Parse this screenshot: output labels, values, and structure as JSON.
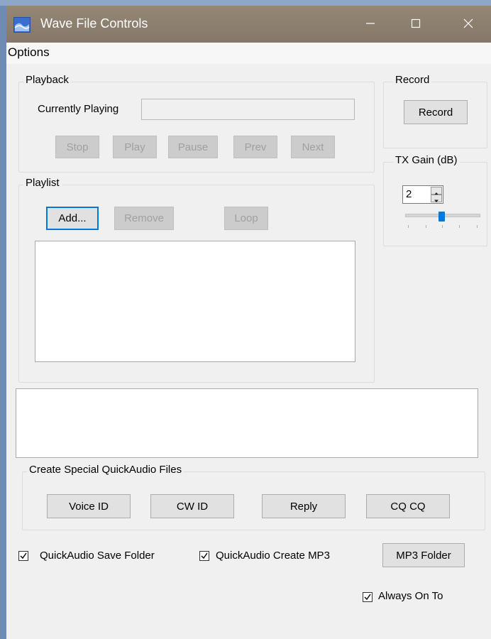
{
  "window": {
    "title": "Wave File Controls"
  },
  "menu": {
    "options": "Options"
  },
  "playback": {
    "group_label": "Playback",
    "currently_playing_label": "Currently Playing",
    "currently_playing_value": "",
    "buttons": {
      "stop": "Stop",
      "play": "Play",
      "pause": "Pause",
      "prev": "Prev",
      "next": "Next"
    }
  },
  "record": {
    "group_label": "Record",
    "button": "Record"
  },
  "tx_gain": {
    "group_label": "TX Gain (dB)",
    "value": "2",
    "slider_fraction": 0.5
  },
  "playlist": {
    "group_label": "Playlist",
    "buttons": {
      "add": "Add...",
      "remove": "Remove",
      "loop": "Loop"
    },
    "items": []
  },
  "status_box": {
    "text": ""
  },
  "special": {
    "group_label": "Create Special QuickAudio Files",
    "buttons": {
      "voice_id": "Voice ID",
      "cw_id": "CW ID",
      "reply": "Reply",
      "cq_cq": "CQ CQ"
    }
  },
  "options": {
    "save_folder": {
      "label": "QuickAudio Save Folder",
      "checked": true
    },
    "create_mp3": {
      "label": "QuickAudio Create MP3",
      "checked": true
    },
    "mp3_folder_button": "MP3 Folder",
    "always_on_top": {
      "label": "Always On To",
      "checked": true
    }
  }
}
